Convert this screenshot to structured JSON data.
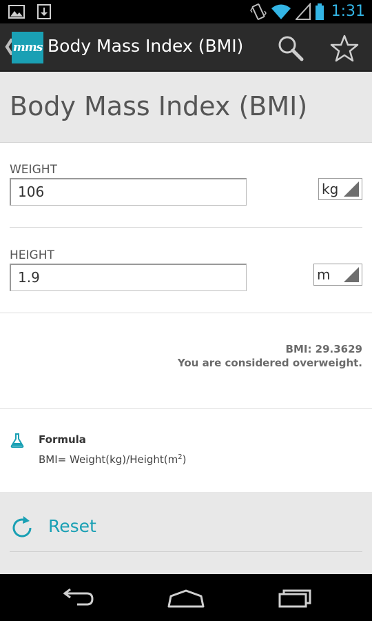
{
  "status_bar": {
    "time": "1:31",
    "icons": [
      "gallery-icon",
      "download-icon",
      "vibrate-icon",
      "wifi-icon",
      "signal-icon",
      "battery-icon"
    ]
  },
  "action_bar": {
    "back_glyph": "❮",
    "app_logo": "mms",
    "title": "Body Mass Index (BMI)",
    "icons": [
      "search-icon",
      "star-icon"
    ]
  },
  "page": {
    "title": "Body Mass Index (BMI)"
  },
  "weight": {
    "label": "WEIGHT",
    "value": "106",
    "unit": "kg"
  },
  "height": {
    "label": "HEIGHT",
    "value": "1.9",
    "unit": "m"
  },
  "result": {
    "bmi": "BMI: 29.3629",
    "message": "You are considered overweight."
  },
  "formula": {
    "title": "Formula",
    "text": "BMI= Weight(kg)/Height(m",
    "superscript": "2",
    "close": ")"
  },
  "reset": {
    "label": "Reset"
  },
  "colors": {
    "accent": "#1aa0b4",
    "status_time": "#33b5e5",
    "action_bar": "#2b2b2b",
    "band": "#e8e8e8"
  },
  "nav_bar": {
    "icons": [
      "back-icon",
      "home-icon",
      "recents-icon"
    ]
  }
}
